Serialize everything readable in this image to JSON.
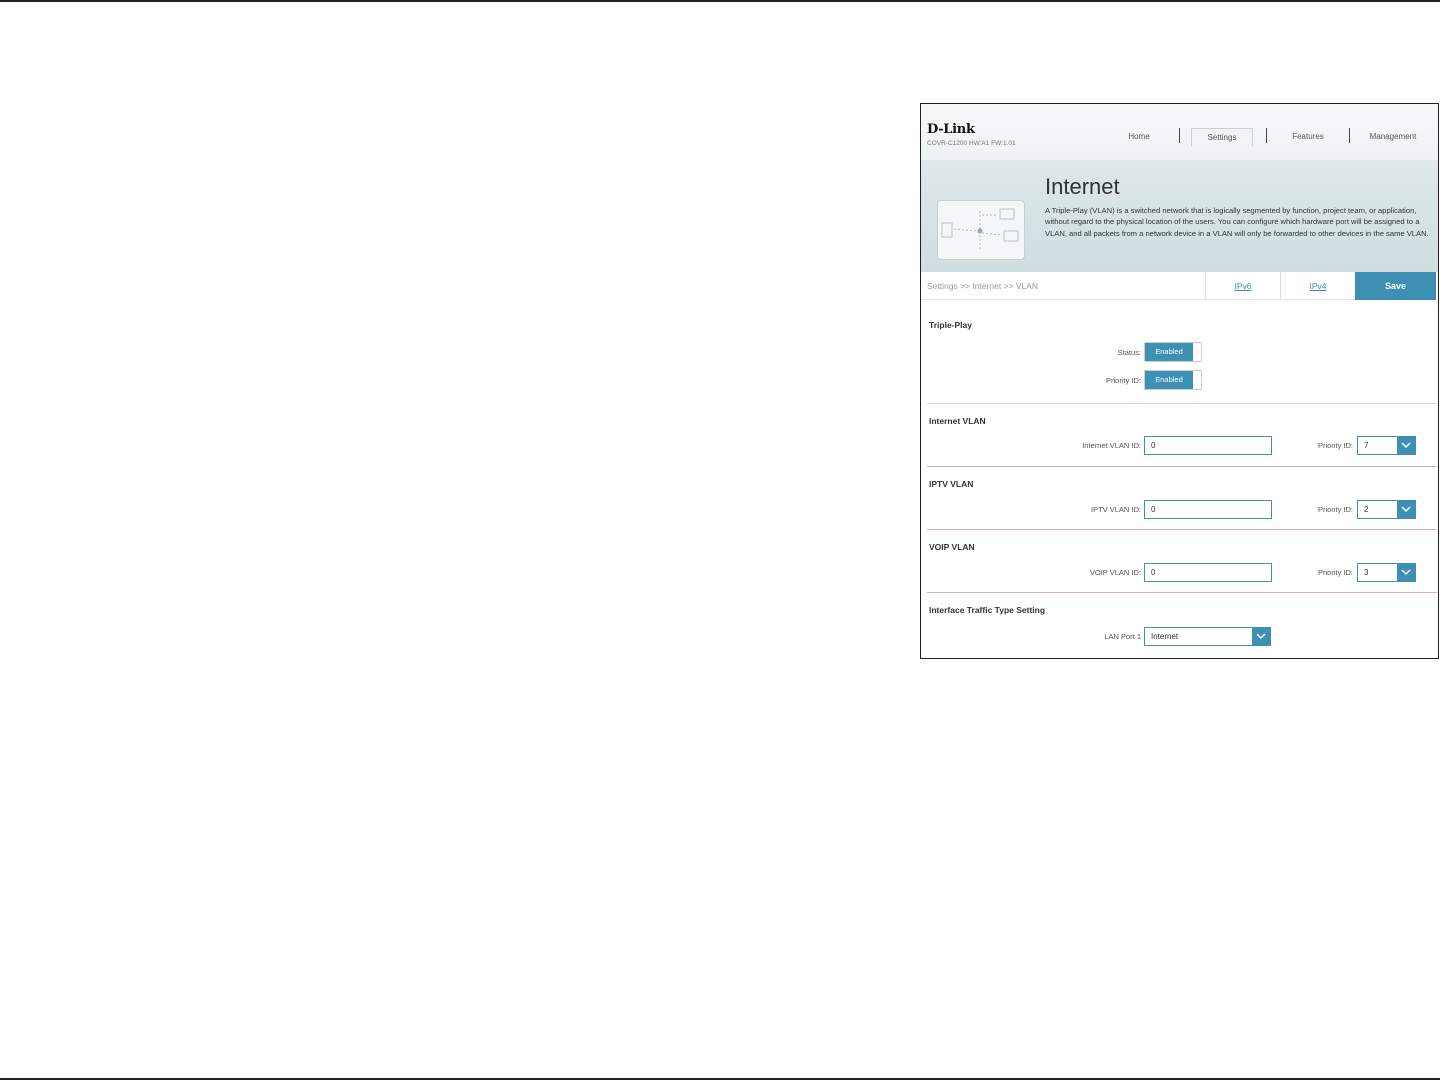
{
  "header": {
    "logo": "D-Link",
    "model": "COVR-C1200 HW:A1 FW:1.01",
    "nav": [
      "Home",
      "Settings",
      "Features",
      "Management"
    ],
    "active_nav": "Settings"
  },
  "banner": {
    "title": "Internet",
    "description": "A Triple-Play (VLAN) is a switched network that is logically segmented by function, project team, or application, without regard to the physical location of the users. You can configure which hardware port will be assigned to a VLAN, and all packets from a network device in a VLAN will only be forwarded to other devices in the same VLAN."
  },
  "breadcrumb": "Settings >> Internet >> VLAN",
  "tabs": {
    "ipv6": "IPv6",
    "ipv4": "IPv4"
  },
  "save_label": "Save",
  "triple_play": {
    "title": "Triple-Play",
    "status_label": "Status:",
    "status_value": "Enabled",
    "priority_label": "Priority ID:",
    "priority_value": "Enabled"
  },
  "internet_vlan": {
    "title": "Internet VLAN",
    "id_label": "Internet VLAN ID:",
    "id_value": "0",
    "priority_label": "Priority ID:",
    "priority_value": "7"
  },
  "iptv_vlan": {
    "title": "IPTV VLAN",
    "id_label": "IPTV VLAN ID:",
    "id_value": "0",
    "priority_label": "Priority ID:",
    "priority_value": "2"
  },
  "voip_vlan": {
    "title": "VOIP VLAN",
    "id_label": "VOIP VLAN ID:",
    "id_value": "0",
    "priority_label": "Priority ID:",
    "priority_value": "3"
  },
  "interface": {
    "title": "Interface Traffic Type Setting",
    "lan_label": "LAN Port 1",
    "lan_value": "Internet"
  },
  "colors": {
    "accent": "#3d8fb4",
    "divider": "#d6b3b3"
  }
}
